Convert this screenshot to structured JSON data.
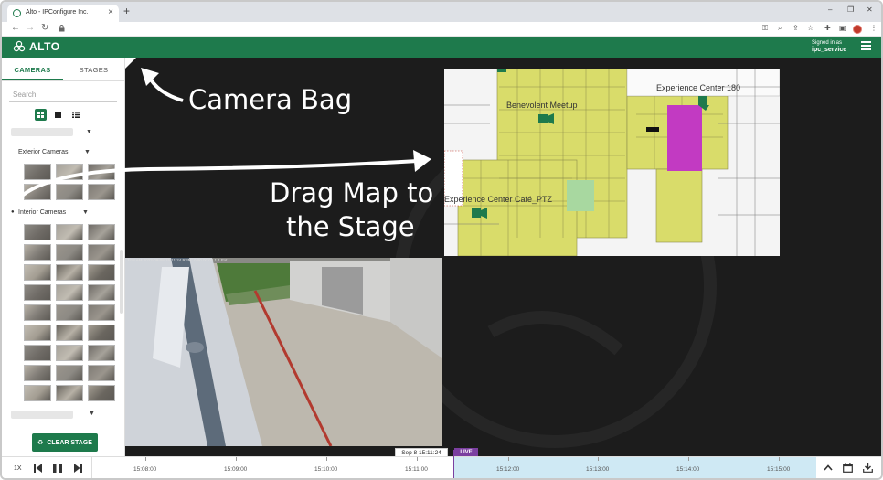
{
  "browser": {
    "tab_title": "Alto - IPConfigure Inc.",
    "tab_close": "×",
    "new_tab": "+",
    "window_controls": [
      "–",
      "❐",
      "✕"
    ],
    "nav_icons": [
      "back-icon",
      "forward-icon",
      "reload-icon"
    ]
  },
  "app": {
    "logo_text": "ALTO",
    "signed_in_label": "Signed in as",
    "username": "ipc_service",
    "brand_color": "#1e7a4c"
  },
  "sidebar": {
    "tabs": [
      {
        "label": "CAMERAS",
        "active": true
      },
      {
        "label": "STAGES",
        "active": false
      }
    ],
    "search_placeholder": "Search",
    "groups": [
      {
        "label": "Exterior Cameras",
        "thumb_count": 6
      },
      {
        "label": "Interior Cameras",
        "thumb_count": 27
      }
    ],
    "clear_stage_label": "CLEAR STAGE"
  },
  "stage": {
    "map_labels": [
      {
        "text": "Benevolent Meetup"
      },
      {
        "text": "Experience Center 180"
      },
      {
        "text": "Experience Center Café_PTZ"
      }
    ],
    "video_osd": "1/18 AM   2022-09-08 15:11:24   RPM: 0.00 00:00   1   1   Ext"
  },
  "annotations": {
    "camera_bag": "Camera Bag",
    "drag_map_line1": "Drag Map to",
    "drag_map_line2": "the Stage"
  },
  "timeline": {
    "speed": "1X",
    "ticks": [
      "15:08:00",
      "15:09:00",
      "15:10:00",
      "15:11:00",
      "15:12:00",
      "15:13:00",
      "15:14:00",
      "15:15:00"
    ],
    "current_time": "Sep 8 15:11:24",
    "live_label": "LIVE",
    "live_color": "#7b3fa0"
  }
}
